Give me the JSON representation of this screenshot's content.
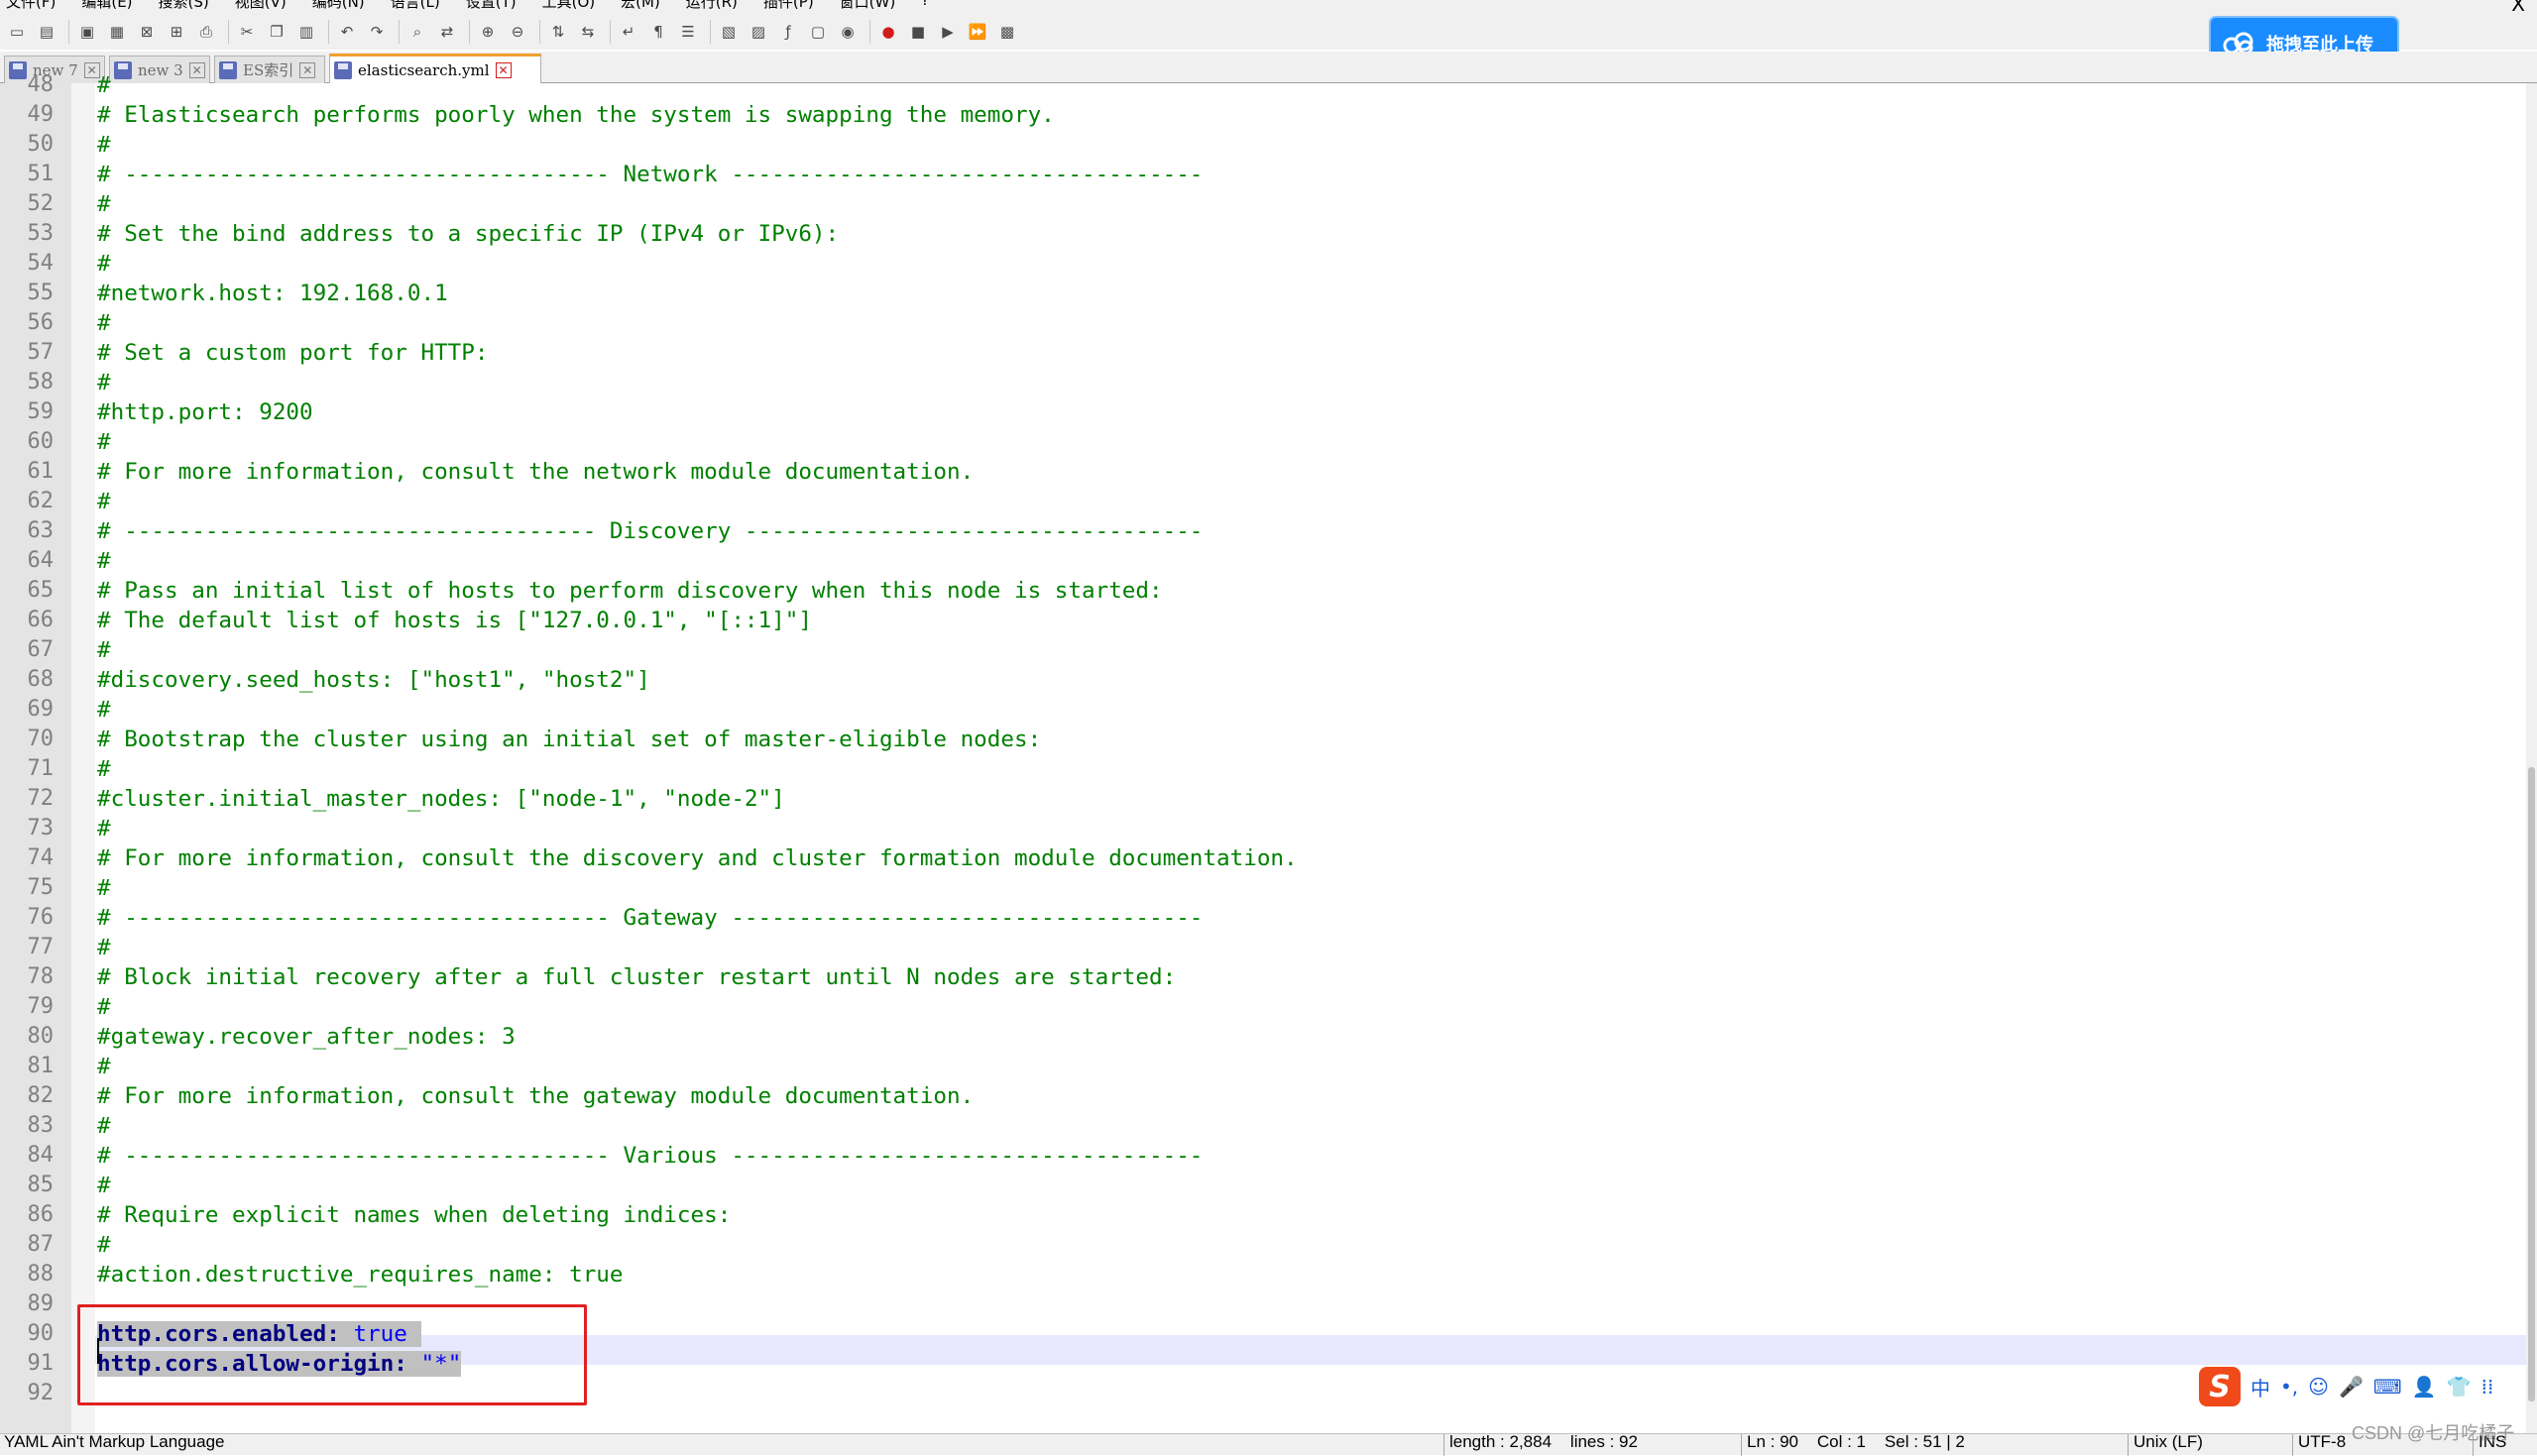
{
  "menu": {
    "items": [
      "文件(F)",
      "编辑(E)",
      "搜索(S)",
      "视图(V)",
      "编码(N)",
      "语言(L)",
      "设置(T)",
      "工具(O)",
      "宏(M)",
      "运行(R)",
      "插件(P)",
      "窗口(W)",
      "?"
    ],
    "close": "X"
  },
  "toolbar": {
    "icons": [
      "new-file-icon",
      "open-file-icon",
      "save-icon",
      "save-all-icon",
      "close-icon",
      "close-all-icon",
      "print-icon",
      "cut-icon",
      "copy-icon",
      "paste-icon",
      "undo-icon",
      "redo-icon",
      "find-icon",
      "replace-icon",
      "zoom-in-icon",
      "zoom-out-icon",
      "sync-v-icon",
      "sync-h-icon",
      "word-wrap-icon",
      "show-all-chars-icon",
      "indent-guide-icon",
      "udl-icon",
      "doc-map-icon",
      "function-list-icon",
      "folder-workspace-icon",
      "monitor-icon",
      "record-macro-icon",
      "stop-macro-icon",
      "play-macro-icon",
      "run-macro-multiple-icon",
      "save-macro-icon"
    ]
  },
  "upload_button": {
    "label": "拖拽至此上传",
    "icon": "cloud-upload-icon",
    "color": "#1a8cff"
  },
  "tabs": [
    {
      "label": "new 7",
      "active": false
    },
    {
      "label": "new 3",
      "active": false
    },
    {
      "label": "ES索引",
      "active": false
    },
    {
      "label": "elasticsearch.yml",
      "active": true
    }
  ],
  "editor": {
    "lines": [
      {
        "n": "48",
        "text": "#"
      },
      {
        "n": "49",
        "text": "# Elasticsearch performs poorly when the system is swapping the memory."
      },
      {
        "n": "50",
        "text": "#"
      },
      {
        "n": "51",
        "text": "# ------------------------------------ Network -----------------------------------"
      },
      {
        "n": "52",
        "text": "#"
      },
      {
        "n": "53",
        "text": "# Set the bind address to a specific IP (IPv4 or IPv6):"
      },
      {
        "n": "54",
        "text": "#"
      },
      {
        "n": "55",
        "text": "#network.host: 192.168.0.1"
      },
      {
        "n": "56",
        "text": "#"
      },
      {
        "n": "57",
        "text": "# Set a custom port for HTTP:"
      },
      {
        "n": "58",
        "text": "#"
      },
      {
        "n": "59",
        "text": "#http.port: 9200"
      },
      {
        "n": "60",
        "text": "#"
      },
      {
        "n": "61",
        "text": "# For more information, consult the network module documentation."
      },
      {
        "n": "62",
        "text": "#"
      },
      {
        "n": "63",
        "text": "# ----------------------------------- Discovery ----------------------------------"
      },
      {
        "n": "64",
        "text": "#"
      },
      {
        "n": "65",
        "text": "# Pass an initial list of hosts to perform discovery when this node is started:"
      },
      {
        "n": "66",
        "text": "# The default list of hosts is [\"127.0.0.1\", \"[::1]\"]"
      },
      {
        "n": "67",
        "text": "#"
      },
      {
        "n": "68",
        "text": "#discovery.seed_hosts: [\"host1\", \"host2\"]"
      },
      {
        "n": "69",
        "text": "#"
      },
      {
        "n": "70",
        "text": "# Bootstrap the cluster using an initial set of master-eligible nodes:"
      },
      {
        "n": "71",
        "text": "#"
      },
      {
        "n": "72",
        "text": "#cluster.initial_master_nodes: [\"node-1\", \"node-2\"]"
      },
      {
        "n": "73",
        "text": "#"
      },
      {
        "n": "74",
        "text": "# For more information, consult the discovery and cluster formation module documentation."
      },
      {
        "n": "75",
        "text": "#"
      },
      {
        "n": "76",
        "text": "# ------------------------------------ Gateway -----------------------------------"
      },
      {
        "n": "77",
        "text": "#"
      },
      {
        "n": "78",
        "text": "# Block initial recovery after a full cluster restart until N nodes are started:"
      },
      {
        "n": "79",
        "text": "#"
      },
      {
        "n": "80",
        "text": "#gateway.recover_after_nodes: 3"
      },
      {
        "n": "81",
        "text": "#"
      },
      {
        "n": "82",
        "text": "# For more information, consult the gateway module documentation."
      },
      {
        "n": "83",
        "text": "#"
      },
      {
        "n": "84",
        "text": "# ------------------------------------ Various -----------------------------------"
      },
      {
        "n": "85",
        "text": "#"
      },
      {
        "n": "86",
        "text": "# Require explicit names when deleting indices:"
      },
      {
        "n": "87",
        "text": "#"
      },
      {
        "n": "88",
        "text": "#action.destructive_requires_name: true"
      },
      {
        "n": "89",
        "text": ""
      }
    ],
    "yaml_lines": [
      {
        "n": "90",
        "key": "http.cors.enabled",
        "sep": ": ",
        "value": "true"
      },
      {
        "n": "91",
        "key": "http.cors.allow-origin",
        "sep": ": ",
        "value": "\"*\""
      }
    ],
    "last_line": {
      "n": "92",
      "text": ""
    },
    "comment_color": "#008000",
    "key_color": "#000080",
    "value_color": "#0000ff",
    "highlight_box_color": "#e02020"
  },
  "ime": {
    "logo": "S",
    "items": [
      "中",
      "•,",
      "☺",
      "🎤",
      "⌨",
      "👤",
      "👕",
      "⁞⁞"
    ]
  },
  "statusbar": {
    "language": "YAML Ain't Markup Language",
    "length": "length : 2,884    lines : 92",
    "position": "Ln : 90    Col : 1    Sel : 51 | 2",
    "eol": "Unix (LF)",
    "encoding": "UTF-8",
    "mode": "INS"
  },
  "watermark": "CSDN @七月吃橘子"
}
